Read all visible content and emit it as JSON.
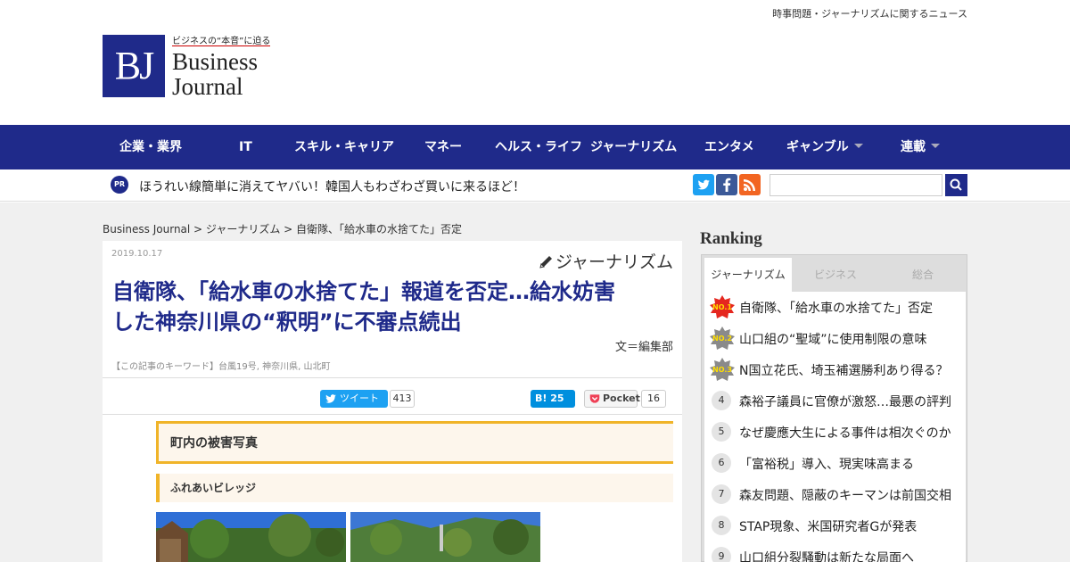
{
  "header": {
    "tagline": "時事問題・ジャーナリズムに関するニュース",
    "logo_mark": "BJ",
    "logo_tag": "ビジネスの“本音”に迫る",
    "logo_name_1": "Business",
    "logo_name_2": "Journal"
  },
  "nav": {
    "items": [
      "企業・業界",
      "IT",
      "スキル・キャリア",
      "マネー",
      "ヘルス・ライフ",
      "ジャーナリズム",
      "エンタメ",
      "ギャンブル",
      "連載"
    ]
  },
  "pr": {
    "badge": "PR",
    "text": "ほうれい線簡単に消えてヤバい！韓国人もわざわざ買いに来るほど！"
  },
  "social_icons": [
    "twitter-icon",
    "facebook-icon",
    "rss-icon"
  ],
  "breadcrumb": "Business Journal > ジャーナリズム > 自衛隊、「給水車の水捨てた」否定",
  "article": {
    "date": "2019.10.17",
    "category": "ジャーナリズム",
    "title_line1": "自衛隊、「給水車の水捨てた」報道を否定…給水妨害",
    "title_line2": "した神奈川県の“釈明”に不審点続出",
    "author": "文＝編集部",
    "keywords": "【この記事のキーワード】台風19号, 神奈川県, 山北町",
    "share": {
      "tweet_label": "ツイート",
      "tweet_count": "413",
      "hatena_label": "B! 25",
      "pocket_label": "Pocket",
      "pocket_count": "16"
    },
    "section_heading": "町内の被害写真",
    "sub_heading": "ふれあいビレッジ"
  },
  "ranking": {
    "title": "Ranking",
    "tabs": [
      "ジャーナリズム",
      "ビジネス",
      "総合"
    ],
    "items": [
      {
        "rank": "NO.1",
        "text": "自衛隊、「給水車の水捨てた」否定"
      },
      {
        "rank": "NO.2",
        "text": "山口組の“聖域”に使用制限の意味"
      },
      {
        "rank": "NO.3",
        "text": "N国立花氏、埼玉補選勝利あり得る？"
      },
      {
        "rank": "4",
        "text": "森裕子議員に官僚が激怒…最悪の評判"
      },
      {
        "rank": "5",
        "text": "なぜ慶應大生による事件は相次ぐのか"
      },
      {
        "rank": "6",
        "text": "「富裕税」導入、現実味高まる"
      },
      {
        "rank": "7",
        "text": "森友問題、隠蔽のキーマンは前国交相"
      },
      {
        "rank": "8",
        "text": "STAP現象、米国研究者Gが発表"
      },
      {
        "rank": "9",
        "text": "山口組分裂騒動は新たな局面へ"
      }
    ]
  },
  "colors": {
    "brand": "#1f2a8a",
    "accent_gold": "#f0b429",
    "twitter": "#1da1f2",
    "facebook": "#3b5998",
    "rss": "#f26522",
    "hatena": "#008fde"
  }
}
